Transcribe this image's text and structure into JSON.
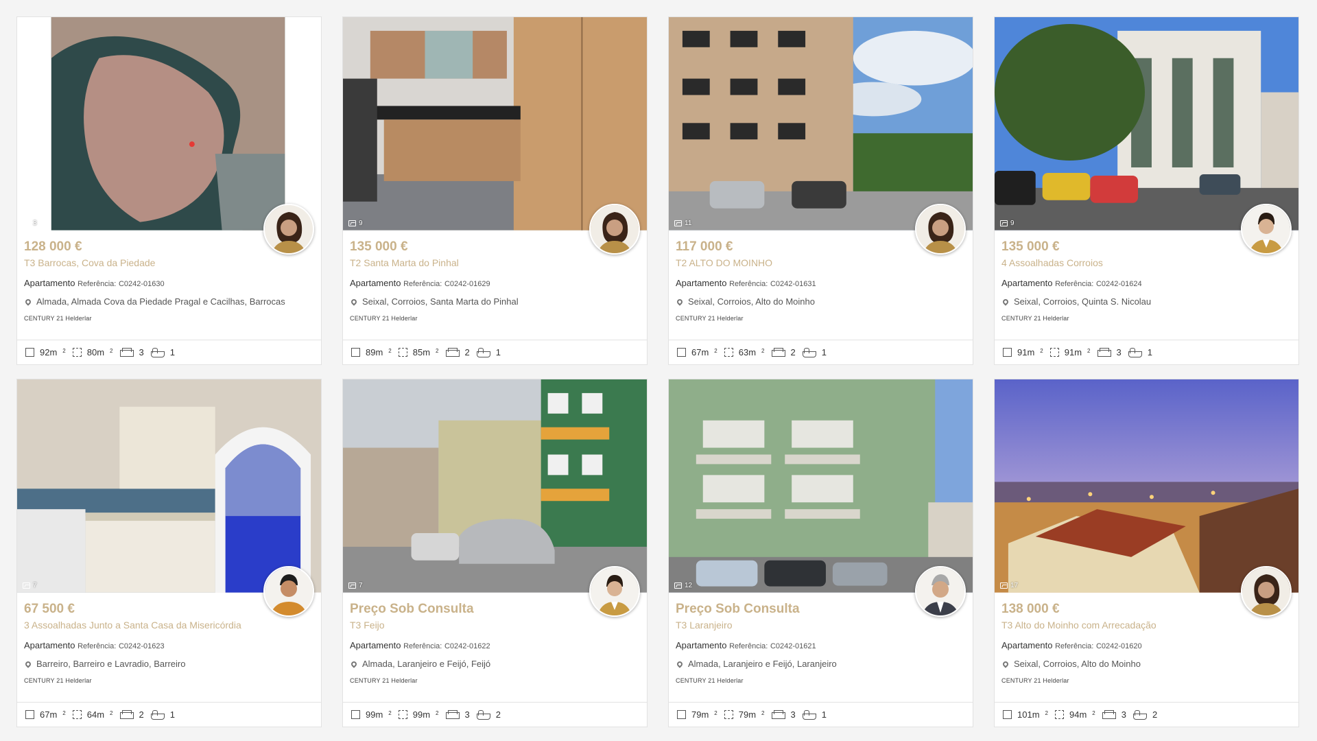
{
  "colors": {
    "accent": "#c9b28a"
  },
  "labels": {
    "reference": "Referência:"
  },
  "listings": [
    {
      "price": "128 000 €",
      "title": "T3 Barrocas, Cova da Piedade",
      "type": "Apartamento",
      "reference": "C0242-01630",
      "location": "Almada, Almada Cova da Piedade Pragal e Cacilhas, Barrocas",
      "agency": "CENTURY 21 Helderlar",
      "photo_count": "3",
      "gross_area": "92m",
      "useful_area": "80m",
      "bedrooms": "3",
      "bathrooms": "1"
    },
    {
      "price": "135 000 €",
      "title": "T2 Santa Marta do Pinhal",
      "type": "Apartamento",
      "reference": "C0242-01629",
      "location": "Seixal, Corroios, Santa Marta do Pinhal",
      "agency": "CENTURY 21 Helderlar",
      "photo_count": "9",
      "gross_area": "89m",
      "useful_area": "85m",
      "bedrooms": "2",
      "bathrooms": "1"
    },
    {
      "price": "117 000 €",
      "title": "T2 ALTO DO MOINHO",
      "type": "Apartamento",
      "reference": "C0242-01631",
      "location": "Seixal, Corroios, Alto do Moinho",
      "agency": "CENTURY 21 Helderlar",
      "photo_count": "11",
      "gross_area": "67m",
      "useful_area": "63m",
      "bedrooms": "2",
      "bathrooms": "1"
    },
    {
      "price": "135 000 €",
      "title": "4 Assoalhadas Corroios",
      "type": "Apartamento",
      "reference": "C0242-01624",
      "location": "Seixal, Corroios, Quinta S. Nicolau",
      "agency": "CENTURY 21 Helderlar",
      "photo_count": "9",
      "gross_area": "91m",
      "useful_area": "91m",
      "bedrooms": "3",
      "bathrooms": "1"
    },
    {
      "price": "67 500 €",
      "title": "3 Assoalhadas Junto a Santa Casa da Misericórdia",
      "type": "Apartamento",
      "reference": "C0242-01623",
      "location": "Barreiro, Barreiro e Lavradio, Barreiro",
      "agency": "CENTURY 21 Helderlar",
      "photo_count": "7",
      "gross_area": "67m",
      "useful_area": "64m",
      "bedrooms": "2",
      "bathrooms": "1"
    },
    {
      "price": "Preço Sob Consulta",
      "title": "T3 Feijo",
      "type": "Apartamento",
      "reference": "C0242-01622",
      "location": "Almada, Laranjeiro e Feijó, Feijó",
      "agency": "CENTURY 21 Helderlar",
      "photo_count": "7",
      "gross_area": "99m",
      "useful_area": "99m",
      "bedrooms": "3",
      "bathrooms": "2"
    },
    {
      "price": "Preço Sob Consulta",
      "title": "T3 Laranjeiro",
      "type": "Apartamento",
      "reference": "C0242-01621",
      "location": "Almada, Laranjeiro e Feijó, Laranjeiro",
      "agency": "CENTURY 21 Helderlar",
      "photo_count": "12",
      "gross_area": "79m",
      "useful_area": "79m",
      "bedrooms": "3",
      "bathrooms": "1"
    },
    {
      "price": "138 000 €",
      "title": "T3 Alto do Moinho com Arrecadação",
      "type": "Apartamento",
      "reference": "C0242-01620",
      "location": "Seixal, Corroios, Alto do Moinho",
      "agency": "CENTURY 21 Helderlar",
      "photo_count": "17",
      "gross_area": "101m",
      "useful_area": "94m",
      "bedrooms": "3",
      "bathrooms": "2"
    }
  ]
}
